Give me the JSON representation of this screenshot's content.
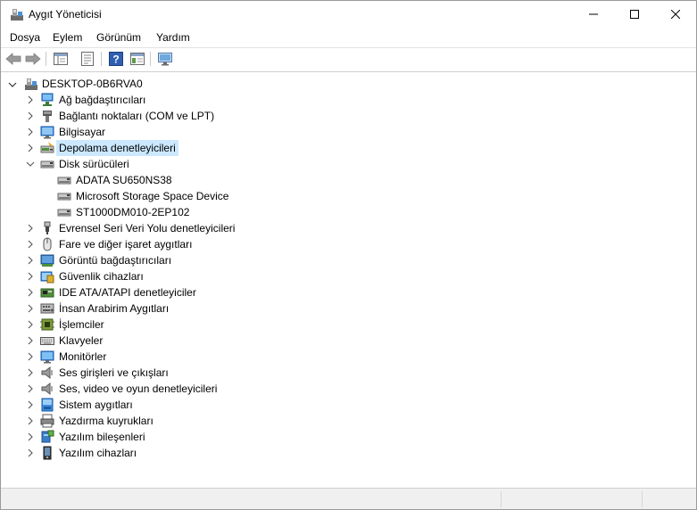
{
  "window": {
    "title": "Aygıt Yöneticisi"
  },
  "menu": [
    "Dosya",
    "Eylem",
    "Görünüm",
    "Yardım"
  ],
  "toolbar": {
    "buttons": [
      "back-icon",
      "forward-icon",
      "properties-pane-icon",
      "show-hide-icon",
      "help-icon",
      "view-icon",
      "monitor-icon"
    ]
  },
  "tree": {
    "root": "DESKTOP-0B6RVA0",
    "categories": [
      {
        "label": "Ağ bağdaştırıcıları",
        "icon": "network-adapter-icon",
        "expanded": false
      },
      {
        "label": "Bağlantı noktaları (COM ve LPT)",
        "icon": "port-icon",
        "expanded": false
      },
      {
        "label": "Bilgisayar",
        "icon": "computer-icon",
        "expanded": false
      },
      {
        "label": "Depolama denetleyicileri",
        "icon": "storage-controller-icon",
        "expanded": false,
        "selected": true
      },
      {
        "label": "Disk sürücüleri",
        "icon": "disk-drive-icon",
        "expanded": true,
        "children": [
          "ADATA SU650NS38",
          "Microsoft Storage Space Device",
          "ST1000DM010-2EP102"
        ]
      },
      {
        "label": "Evrensel Seri Veri Yolu denetleyicileri",
        "icon": "usb-icon",
        "expanded": false
      },
      {
        "label": "Fare ve diğer işaret aygıtları",
        "icon": "mouse-icon",
        "expanded": false
      },
      {
        "label": "Görüntü bağdaştırıcıları",
        "icon": "display-adapter-icon",
        "expanded": false
      },
      {
        "label": "Güvenlik cihazları",
        "icon": "security-device-icon",
        "expanded": false
      },
      {
        "label": "IDE ATA/ATAPI denetleyiciler",
        "icon": "ide-controller-icon",
        "expanded": false
      },
      {
        "label": "İnsan Arabirim Aygıtları",
        "icon": "hid-icon",
        "expanded": false
      },
      {
        "label": "İşlemciler",
        "icon": "processor-icon",
        "expanded": false
      },
      {
        "label": "Klavyeler",
        "icon": "keyboard-icon",
        "expanded": false
      },
      {
        "label": "Monitörler",
        "icon": "monitor-icon",
        "expanded": false
      },
      {
        "label": "Ses girişleri ve çıkışları",
        "icon": "speaker-icon",
        "expanded": false
      },
      {
        "label": "Ses, video ve oyun denetleyicileri",
        "icon": "sound-video-icon",
        "expanded": false
      },
      {
        "label": "Sistem aygıtları",
        "icon": "system-devices-icon",
        "expanded": false
      },
      {
        "label": "Yazdırma kuyrukları",
        "icon": "print-queue-icon",
        "expanded": false
      },
      {
        "label": "Yazılım bileşenleri",
        "icon": "software-component-icon",
        "expanded": false
      },
      {
        "label": "Yazılım cihazları",
        "icon": "software-device-icon",
        "expanded": false
      }
    ]
  },
  "colors": {
    "selection": "#cce8ff",
    "accent": "#0078d7"
  }
}
